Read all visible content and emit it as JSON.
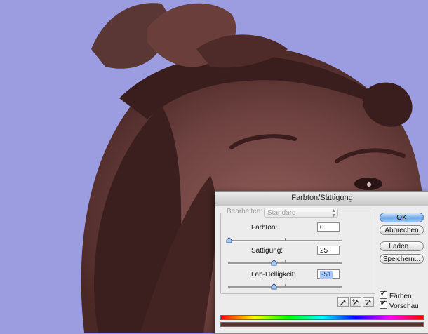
{
  "dialog": {
    "title": "Farbton/Sättigung",
    "edit_label": "Bearbeiten:",
    "edit_value": "Standard",
    "hue": {
      "label": "Farbton:",
      "value": "0"
    },
    "saturation": {
      "label": "Sättigung:",
      "value": "25"
    },
    "lightness": {
      "label": "Lab-Helligkeit:",
      "value": "-51"
    },
    "buttons": {
      "ok": "OK",
      "cancel": "Abbrechen",
      "load": "Laden...",
      "save": "Speichern..."
    },
    "checkboxes": {
      "colorize": "Färben",
      "preview": "Vorschau"
    },
    "colors": {
      "background": "#9c9ce0",
      "tint": "#5a3230",
      "default_button": "#6ea6e8"
    }
  }
}
